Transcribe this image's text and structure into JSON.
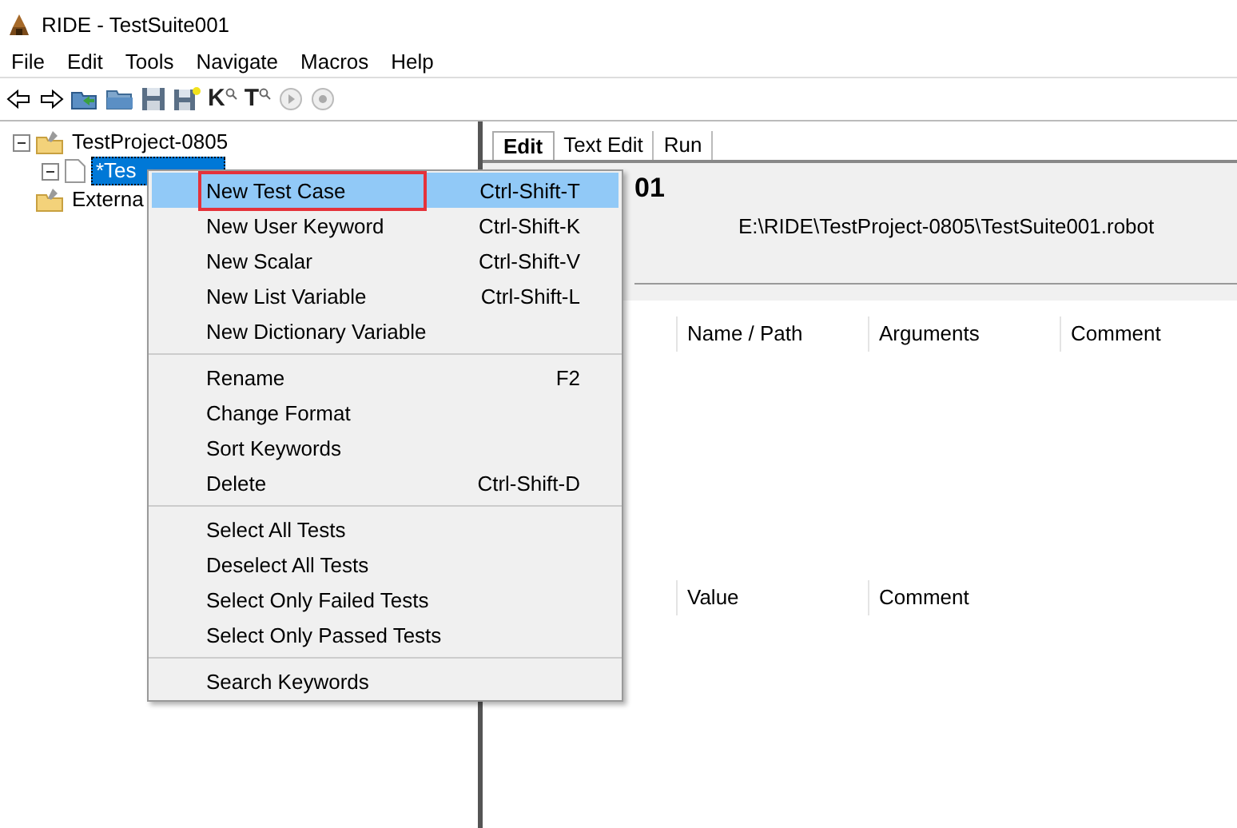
{
  "window": {
    "title": "RIDE - TestSuite001"
  },
  "menu_bar": [
    "File",
    "Edit",
    "Tools",
    "Navigate",
    "Macros",
    "Help"
  ],
  "toolbar": [
    {
      "kind": "back"
    },
    {
      "kind": "forward"
    },
    {
      "kind": "open_dir"
    },
    {
      "kind": "open"
    },
    {
      "kind": "save"
    },
    {
      "kind": "save_all"
    },
    {
      "kind": "letter",
      "label": "K"
    },
    {
      "kind": "letter",
      "label": "T"
    },
    {
      "kind": "run"
    },
    {
      "kind": "stop"
    }
  ],
  "tree": [
    {
      "label": "TestProject-0805",
      "kind": "project",
      "expanded": true,
      "selected": false,
      "children": [
        {
          "label": "*Tes",
          "kind": "file",
          "expanded": true,
          "selected": true
        }
      ]
    },
    {
      "label": "Externa",
      "kind": "project",
      "selected": false
    }
  ],
  "tabs": [
    {
      "label": "Edit",
      "selected": true
    },
    {
      "label": "Text Edit",
      "selected": false
    },
    {
      "label": "Run",
      "selected": false
    }
  ],
  "editor": {
    "title": "01",
    "source": "E:\\RIDE\\TestProject-0805\\TestSuite001.robot",
    "import_columns": [
      "Name / Path",
      "Arguments",
      "Comment"
    ],
    "variable_columns": [
      "Value",
      "Comment"
    ]
  },
  "context_menu": {
    "groups": [
      [
        {
          "label": "New Test Case",
          "shortcut": "Ctrl-Shift-T",
          "selected": true,
          "outlined": true
        },
        {
          "label": "New User Keyword",
          "shortcut": "Ctrl-Shift-K",
          "selected": false
        },
        {
          "label": "New Scalar",
          "shortcut": "Ctrl-Shift-V",
          "selected": false
        },
        {
          "label": "New List Variable",
          "shortcut": "Ctrl-Shift-L",
          "selected": false
        },
        {
          "label": "New Dictionary Variable",
          "selected": false
        }
      ],
      [
        {
          "label": "Rename",
          "shortcut": "F2",
          "selected": false
        },
        {
          "label": "Change Format",
          "selected": false
        },
        {
          "label": "Sort Keywords",
          "selected": false
        },
        {
          "label": "Delete",
          "shortcut": "Ctrl-Shift-D",
          "selected": false
        }
      ],
      [
        {
          "label": "Select All Tests",
          "selected": false
        },
        {
          "label": "Deselect All Tests",
          "selected": false
        },
        {
          "label": "Select Only Failed Tests",
          "selected": false
        },
        {
          "label": "Select Only Passed Tests",
          "selected": false
        }
      ],
      [
        {
          "label": "Search Keywords",
          "selected": false
        }
      ]
    ]
  }
}
